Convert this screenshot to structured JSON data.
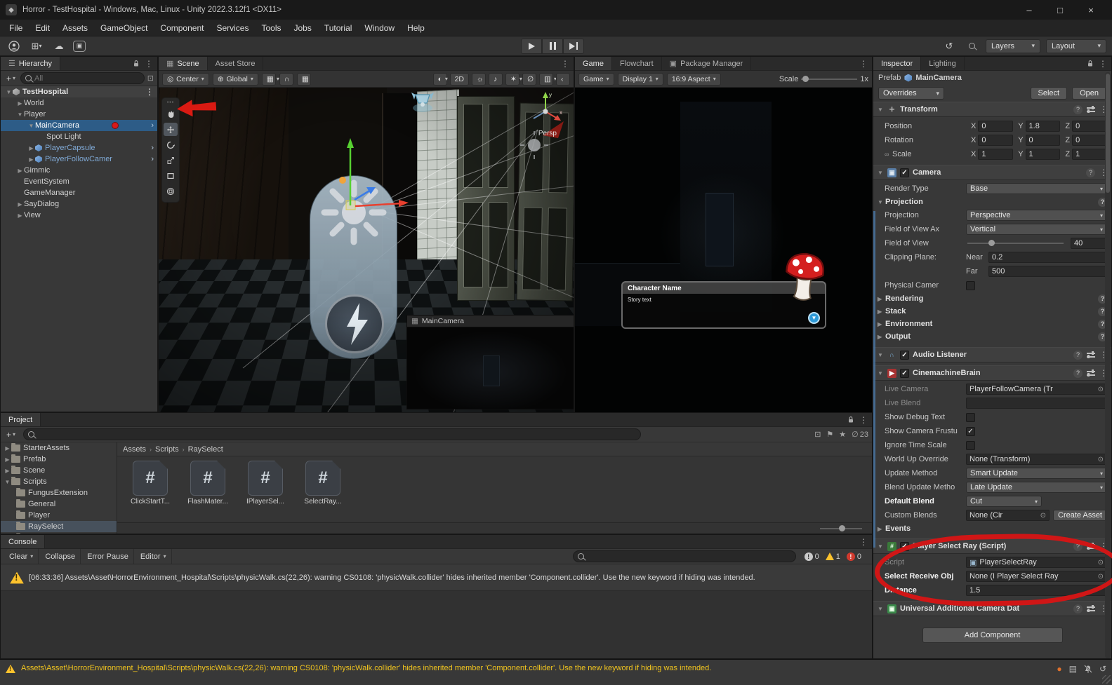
{
  "window": {
    "title": "Horror - TestHospital - Windows, Mac, Linux - Unity 2022.3.12f1 <DX11>"
  },
  "menu": {
    "items": [
      "File",
      "Edit",
      "Assets",
      "GameObject",
      "Component",
      "Services",
      "Tools",
      "Jobs",
      "Tutorial",
      "Window",
      "Help"
    ]
  },
  "toolbar": {
    "layers_label": "Layers",
    "layout_label": "Layout"
  },
  "hierarchy": {
    "tab": "Hierarchy",
    "search_placeholder": "All",
    "items": [
      {
        "label": "TestHospital"
      },
      {
        "label": "World"
      },
      {
        "label": "Player"
      },
      {
        "label": "MainCamera"
      },
      {
        "label": "Spot Light"
      },
      {
        "label": "PlayerCapsule"
      },
      {
        "label": "PlayerFollowCamer"
      },
      {
        "label": "Gimmic"
      },
      {
        "label": "EventSystem"
      },
      {
        "label": "GameManager"
      },
      {
        "label": "SayDialog"
      },
      {
        "label": "View"
      }
    ]
  },
  "scene": {
    "tabs": [
      "Scene",
      "Asset Store"
    ],
    "pivot_label": "Center",
    "orientation_label": "Global",
    "view_2d_label": "2D",
    "projection_label": "Persp",
    "camera_preview_title": "MainCamera"
  },
  "game": {
    "tabs": [
      "Game",
      "Flowchart",
      "Package Manager"
    ],
    "display_target": "Game",
    "display": "Display 1",
    "aspect": "16:9 Aspect",
    "scale_label": "Scale",
    "scale_value": "1x",
    "dialog": {
      "character_name": "Character Name",
      "story_text": "Story text"
    }
  },
  "inspector": {
    "tabs": [
      "Inspector",
      "Lighting"
    ],
    "prefab_label": "Prefab",
    "prefab_name": "MainCamera",
    "overrides_label": "Overrides",
    "select_button": "Select",
    "open_button": "Open",
    "transform": {
      "title": "Transform",
      "axis_labels": [
        "X",
        "Y",
        "Z"
      ],
      "rows": [
        {
          "label": "Position",
          "x": "0",
          "y": "1.8",
          "z": "0"
        },
        {
          "label": "Rotation",
          "x": "0",
          "y": "0",
          "z": "0"
        },
        {
          "label": "Scale",
          "x": "1",
          "y": "1",
          "z": "1"
        }
      ]
    },
    "camera": {
      "title": "Camera",
      "render_type_label": "Render Type",
      "render_type_value": "Base",
      "projection_section": "Projection",
      "projection_label": "Projection",
      "projection_value": "Perspective",
      "fov_axis_label": "Field of View Ax",
      "fov_axis_value": "Vertical",
      "fov_label": "Field of View",
      "fov_value": "40",
      "clipping_label": "Clipping Plane:",
      "near_label": "Near",
      "near_value": "0.2",
      "far_label": "Far",
      "far_value": "500",
      "physical_label": "Physical Camer",
      "foldouts": [
        "Rendering",
        "Stack",
        "Environment",
        "Output"
      ]
    },
    "audio_listener_title": "Audio Listener",
    "cinemachine": {
      "title": "CinemachineBrain",
      "rows": [
        {
          "label": "Live Camera",
          "value": "PlayerFollowCamera (Tr"
        },
        {
          "label": "Live Blend",
          "value": ""
        },
        {
          "label": "Show Debug Text"
        },
        {
          "label": "Show Camera Frustu"
        },
        {
          "label": "Ignore Time Scale"
        },
        {
          "label": "World Up Override",
          "value": "None (Transform)"
        },
        {
          "label": "Update Method",
          "value": "Smart Update"
        },
        {
          "label": "Blend Update Metho",
          "value": "Late Update"
        },
        {
          "label": "Default Blend",
          "value": "Cut"
        },
        {
          "label": "Custom Blends",
          "value": "None (Cir"
        }
      ],
      "create_asset_button": "Create Asset",
      "events_foldout": "Events"
    },
    "player_select_ray": {
      "title": "Player Select Ray (Script)",
      "script_label": "Script",
      "script_value": "PlayerSelectRay",
      "receive_label": "Select Receive Obj",
      "receive_value": "None (I Player Select Ray",
      "distance_label": "Distance",
      "distance_value": "1.5"
    },
    "universal_camera_title": "Universal Additional Camera Dat",
    "add_component_button": "Add Component"
  },
  "project": {
    "tab": "Project",
    "hidden_count": "23",
    "folders": [
      {
        "label": "StarterAssets"
      },
      {
        "label": "Prefab"
      },
      {
        "label": "Scene"
      },
      {
        "label": "Scripts"
      },
      {
        "label": "FungusExtension"
      },
      {
        "label": "General"
      },
      {
        "label": "Player"
      },
      {
        "label": "RaySelect"
      },
      {
        "label": "TestHospital"
      }
    ],
    "breadcrumb": [
      "Assets",
      "Scripts",
      "RaySelect"
    ],
    "files": [
      {
        "label": "ClickStartT..."
      },
      {
        "label": "FlashMater..."
      },
      {
        "label": "IPlayerSel..."
      },
      {
        "label": "SelectRay..."
      }
    ]
  },
  "console": {
    "tab": "Console",
    "clear_button": "Clear",
    "collapse_button": "Collapse",
    "error_pause_button": "Error Pause",
    "editor_button": "Editor",
    "info_count": "0",
    "warning_count": "1",
    "error_count": "0",
    "log_entry": "[06:33:36] Assets\\Asset\\HorrorEnvironment_Hospital\\Scripts\\physicWalk.cs(22,26): warning CS0108: 'physicWalk.collider' hides inherited member 'Component.collider'. Use the new keyword if hiding was intended."
  },
  "status_bar": {
    "message": "Assets\\Asset\\HorrorEnvironment_Hospital\\Scripts\\physicWalk.cs(22,26): warning CS0108: 'physicWalk.collider' hides inherited member 'Component.collider'. Use the new keyword if hiding was intended."
  },
  "colors": {
    "annotation_red": "#d81a1a",
    "selection_blue": "#2d5c87",
    "warning_yellow": "#fdc22d"
  }
}
